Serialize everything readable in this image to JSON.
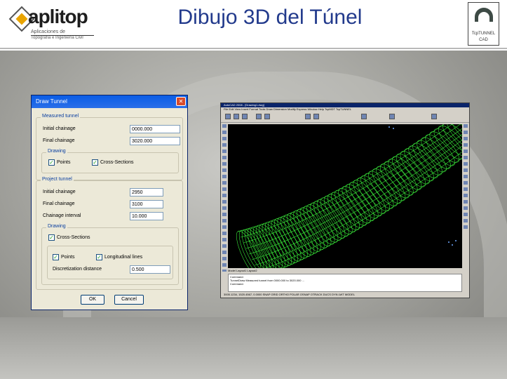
{
  "header": {
    "logo_name": "aplitop",
    "logo_sub1": "Aplicaciones de",
    "logo_sub2": "Topografía e Ingeniería Civil",
    "title": "Dibujo 3D del Túnel",
    "badge_line1": "TcpTUNNEL",
    "badge_line2": "CAD"
  },
  "dialog": {
    "title": "Draw Tunnel",
    "close_glyph": "✕",
    "measured": {
      "legend": "Measured tunnel",
      "initial_label": "Initial chainage",
      "initial_value": "0000.000",
      "final_label": "Final chainage",
      "final_value": "3020.000",
      "drawing_legend": "Drawing",
      "points_label": "Points",
      "points_checked": true,
      "cross_label": "Cross-Sections",
      "cross_checked": true
    },
    "project": {
      "legend": "Project tunnel",
      "initial_label": "Initial chainage",
      "initial_value": "2950",
      "final_label": "Final chainage",
      "final_value": "3100",
      "interval_label": "Chainage interval",
      "interval_value": "10.000",
      "drawing_legend": "Drawing",
      "cross_label": "Cross-Sections",
      "cross_checked": true,
      "points_label": "Points",
      "points_checked": true,
      "long_label": "Longitudinal lines",
      "long_checked": true,
      "disc_label": "Discretization distance",
      "disc_value": "0.500"
    },
    "ok_label": "OK",
    "cancel_label": "Cancel",
    "check_glyph": "✓"
  },
  "app": {
    "title": "AutoCAD 2008 - [Drawing1.dwg]",
    "menu": "File  Edit  View  Insert  Format  Tools  Draw  Dimension  Modify  Express  Window  Help  TcpMDT  TcpTUNNEL",
    "tabs": "Model  Layout1  Layout2",
    "cmd_line1": "Command:",
    "cmd_line2": "TunnelDraw  Measured tunnel from 0000.000 to 3020.000 ...",
    "cmd_line3": "Command:",
    "status": "3005.1234, 1520.4567, 0.0000   SNAP  GRID  ORTHO  POLAR  OSNAP  OTRACK  DUCS  DYN  LWT  MODEL"
  },
  "colors": {
    "title": "#223a8c",
    "wireframe": "#39e639",
    "dialog_bg": "#ece9d8",
    "titlebar": "#0a5ce6"
  }
}
